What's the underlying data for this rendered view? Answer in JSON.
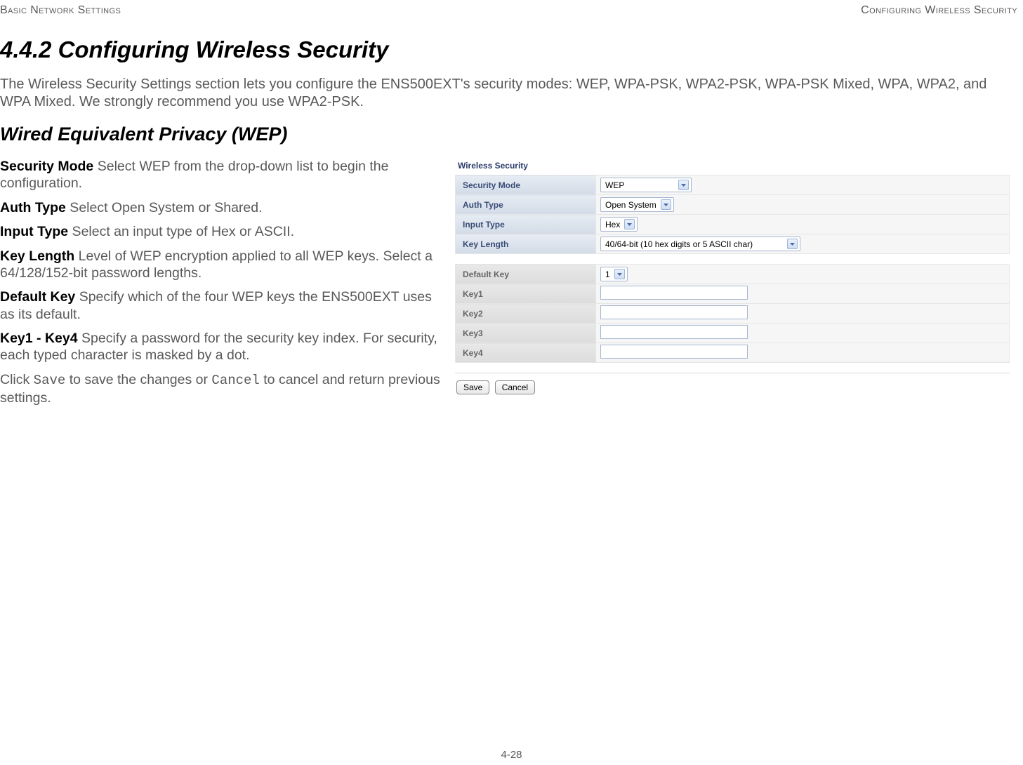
{
  "header": {
    "left": "Basic Network Settings",
    "right": "Configuring Wireless Security"
  },
  "headings": {
    "main": "4.4.2 Configuring Wireless Security",
    "sub": "Wired Equivalent Privacy (WEP)"
  },
  "intro": "The Wireless Security Settings section lets you configure the ENS500EXT's security modes: WEP, WPA-PSK, WPA2-PSK, WPA-PSK Mixed, WPA, WPA2, and WPA Mixed. We strongly recommend you use WPA2-PSK.",
  "definitions": {
    "securityMode": {
      "term": "Security Mode",
      "desc": "  Select WEP from the drop-down list to begin the configuration."
    },
    "authType": {
      "term": "Auth Type",
      "desc": "  Select Open System or Shared."
    },
    "inputType": {
      "term": "Input Type",
      "desc": "  Select an input type of Hex or ASCII."
    },
    "keyLength": {
      "term": "Key Length",
      "desc": "  Level of WEP encryption applied to all WEP keys. Select a 64/128/152-bit password lengths."
    },
    "defaultKey": {
      "term": "Default Key",
      "desc": "  Specify which of the four WEP keys the ENS500EXT uses as its default."
    },
    "keys": {
      "term": "Key1 - Key4",
      "desc": "  Specify a password for the security key index. For security, each typed character is masked by a dot."
    }
  },
  "saveLine": {
    "p1": "Click ",
    "save": "Save",
    "p2": " to save the changes or ",
    "cancel": "Cancel",
    "p3": " to cancel and return previous settings."
  },
  "panel": {
    "title": "Wireless Security",
    "rows": {
      "securityMode": {
        "label": "Security Mode",
        "value": "WEP"
      },
      "authType": {
        "label": "Auth Type",
        "value": "Open System"
      },
      "inputType": {
        "label": "Input Type",
        "value": "Hex"
      },
      "keyLength": {
        "label": "Key Length",
        "value": "40/64-bit (10 hex digits or 5 ASCII char)"
      }
    },
    "keys": {
      "defaultKey": {
        "label": "Default Key",
        "value": "1"
      },
      "key1": {
        "label": "Key1",
        "value": ""
      },
      "key2": {
        "label": "Key2",
        "value": ""
      },
      "key3": {
        "label": "Key3",
        "value": ""
      },
      "key4": {
        "label": "Key4",
        "value": ""
      }
    },
    "buttons": {
      "save": "Save",
      "cancel": "Cancel"
    }
  },
  "footer": {
    "page": "4-28"
  }
}
